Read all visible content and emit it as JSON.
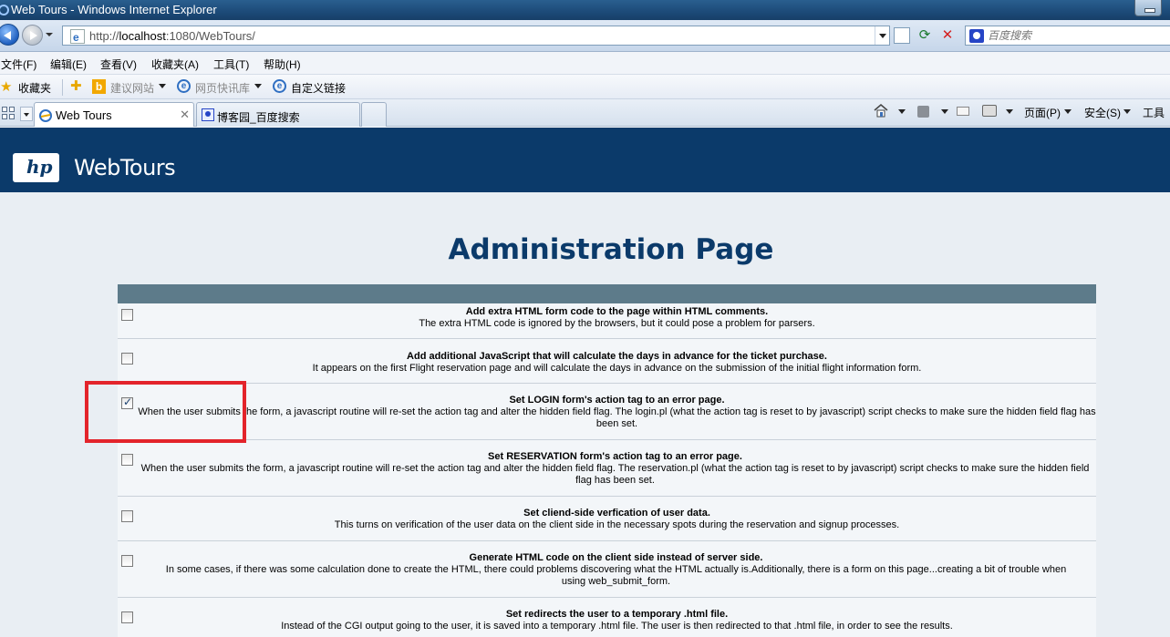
{
  "window": {
    "title": "Web Tours - Windows Internet Explorer"
  },
  "address_bar": {
    "url_prefix": "http://",
    "url_host": "localhost",
    "url_rest": ":1080/WebTours/"
  },
  "search": {
    "placeholder": "百度搜索"
  },
  "menu": [
    "文件(F)",
    "编辑(E)",
    "查看(V)",
    "收藏夹(A)",
    "工具(T)",
    "帮助(H)"
  ],
  "favorites_bar": {
    "favorites_label": "收藏夹",
    "items": [
      "建议网站",
      "网页快讯库",
      "自定义链接"
    ]
  },
  "tabs": [
    {
      "label": "Web Tours",
      "active": true
    },
    {
      "label": "博客园_百度搜索",
      "active": false
    }
  ],
  "command_bar": {
    "page": "页面(P)",
    "safety": "安全(S)",
    "tools": "工具"
  },
  "site": {
    "brand": "WebTours",
    "logo_text": "hp"
  },
  "page": {
    "title": "Administration Page"
  },
  "options": [
    {
      "checked": false,
      "title": "Add extra HTML form code to the page within HTML comments.",
      "desc": "The extra HTML code is ignored by the browsers, but it could pose a problem for parsers."
    },
    {
      "checked": false,
      "title": "Add additional JavaScript that will calculate the days in advance for the ticket purchase.",
      "desc": "It appears on the first Flight reservation page and will calculate the days in advance on the submission of the initial flight information form."
    },
    {
      "checked": true,
      "title": "Set LOGIN form's action tag to an error page.",
      "desc": "When the user submits the form, a javascript routine will re-set the action tag and alter the hidden field flag. The login.pl (what the action tag is reset to by javascript) script checks to make sure the hidden field flag has been set."
    },
    {
      "checked": false,
      "title": "Set RESERVATION form's action tag to an error page.",
      "desc": "When the user submits the form, a javascript routine will re-set the action tag and alter the hidden field flag. The reservation.pl (what the action tag is reset to by javascript) script checks to make sure the hidden field flag has been set."
    },
    {
      "checked": false,
      "title": "Set cliend-side verfication of user data.",
      "desc": "This turns on verification of the user data on the client side in the necessary spots during the reservation and signup processes."
    },
    {
      "checked": false,
      "title": "Generate HTML code on the client side instead of server side.",
      "desc": "In some cases, if there was some calculation done to create the HTML, there could problems discovering what the HTML actually is.Additionally, there is a form on this page...creating a bit of trouble when using web_submit_form."
    },
    {
      "checked": false,
      "title": "Set redirects the user to a temporary .html file.",
      "desc": "Instead of the CGI output going to the user, it is saved into a temporary .html file. The user is then redirected to that .html file, in order to see the results."
    }
  ]
}
